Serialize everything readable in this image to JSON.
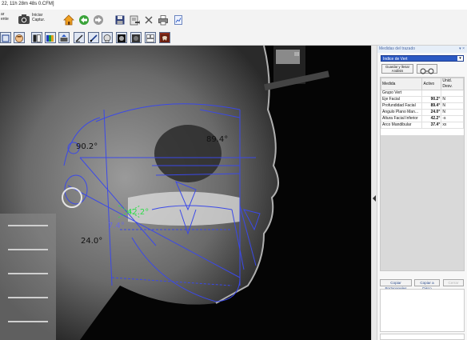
{
  "window": {
    "title": "22, 11h 28m 48s 0.CFM]"
  },
  "toolbar1": {
    "partial_label_top": "ar",
    "partial_label_bottom": "ente",
    "capture_label_top": "Iniciar",
    "capture_label_bottom": "Captur."
  },
  "panel": {
    "header_title": "Medidas del trazado",
    "header_icons": "▾ ×",
    "selected_analysis": "Indice de Vert",
    "dropdown_arrow": "▾",
    "save_button_line1": "Guardar y llenar",
    "save_button_line2": "Análisis",
    "table": {
      "columns": [
        "Medida",
        "Activo",
        "Unid. Desv."
      ],
      "group_label": "Grupo Vert",
      "rows": [
        {
          "name": "Eje Facial",
          "value": "90.2°",
          "unit": "N"
        },
        {
          "name": "Profundidad Facial",
          "value": "89.4°",
          "unit": "N"
        },
        {
          "name": "Ángulo Plano Man...",
          "value": "24.0°",
          "unit": "N"
        },
        {
          "name": "Altura Facial Inferior",
          "value": "42.2°",
          "unit": "-s"
        },
        {
          "name": "Arco Mandibular",
          "value": "37.4°",
          "unit": "xx"
        }
      ]
    },
    "copy_clipboard_label": "Copiar Portapapeles",
    "copy_disk_label": "Copiar a Disco",
    "close_label": "Cerrar"
  },
  "ceph_labels": {
    "facial_axis": "90.2°",
    "facial_depth": "89.4°",
    "lower_face_height": "42.2°",
    "mandibular_arc": "7.4°",
    "mandibular_plane": "24.0°",
    "ruler_marks": "III"
  },
  "colors": {
    "tracing_blue": "#3b49e8",
    "tracing_green": "#2fdc4a",
    "select_blue": "#2b59c3"
  }
}
